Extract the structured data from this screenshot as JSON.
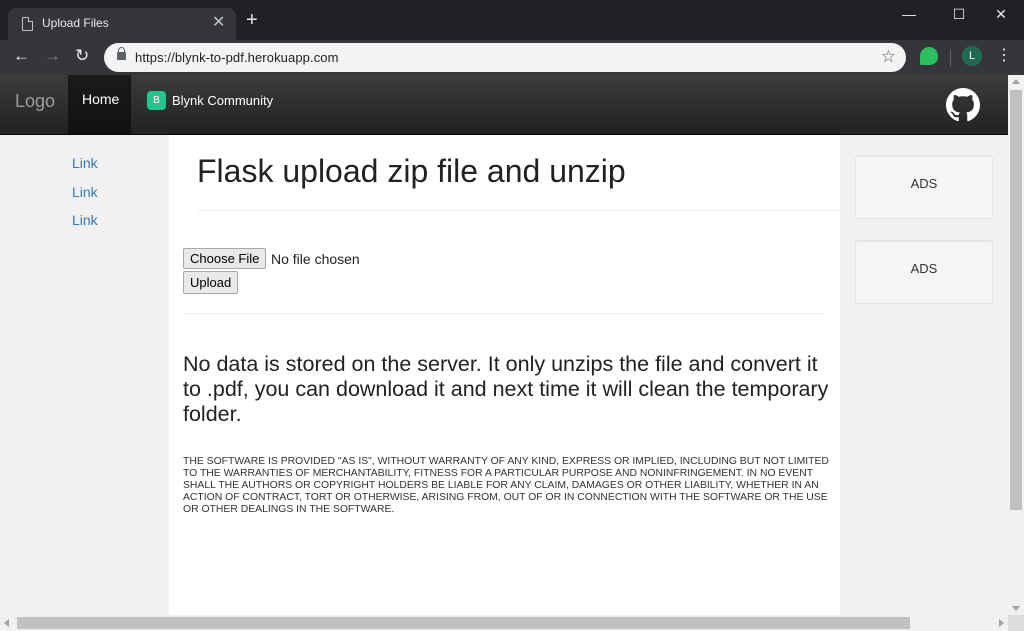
{
  "browser": {
    "tab_title": "Upload Files",
    "tab_close": "✕",
    "new_tab": "+",
    "url": "https://blynk-to-pdf.herokuapp.com",
    "back": "←",
    "forward": "→",
    "reload": "↻",
    "star": "☆",
    "profile_initial": "L",
    "menu": "⋮",
    "minimize": "—",
    "maximize": "☐",
    "close": "✕"
  },
  "navbar": {
    "brand": "Logo",
    "home": "Home",
    "community_badge": "B",
    "community": "Blynk Community"
  },
  "sidenav": {
    "links": [
      "Link",
      "Link",
      "Link"
    ]
  },
  "main": {
    "title": "Flask upload zip file and unzip",
    "choose_file": "Choose File",
    "file_status": "No file chosen",
    "upload": "Upload",
    "notice": "No data is stored on the server. It only unzips the file and convert it to .pdf, you can download it and next time it will clean the temporary folder.",
    "license": "THE SOFTWARE IS PROVIDED \"AS IS\", WITHOUT WARRANTY OF ANY KIND, EXPRESS OR IMPLIED, INCLUDING BUT NOT LIMITED TO THE WARRANTIES OF MERCHANTABILITY, FITNESS FOR A PARTICULAR PURPOSE AND NONINFRINGEMENT. IN NO EVENT SHALL THE AUTHORS OR COPYRIGHT HOLDERS BE LIABLE FOR ANY CLAIM, DAMAGES OR OTHER LIABILITY, WHETHER IN AN ACTION OF CONTRACT, TORT OR OTHERWISE, ARISING FROM, OUT OF OR IN CONNECTION WITH THE SOFTWARE OR THE USE OR OTHER DEALINGS IN THE SOFTWARE."
  },
  "rightnav": {
    "ads": [
      "ADS",
      "ADS"
    ]
  },
  "colors": {
    "link": "#337ab7",
    "navbar": "#222222",
    "community_badge": "#23c48e",
    "chrome_bg": "#202124",
    "toolbar_bg": "#35363a"
  },
  "icons": {
    "tab_favicon": "page-icon",
    "lock": "lock-icon",
    "extension": "evernote-icon",
    "github": "github-icon"
  }
}
